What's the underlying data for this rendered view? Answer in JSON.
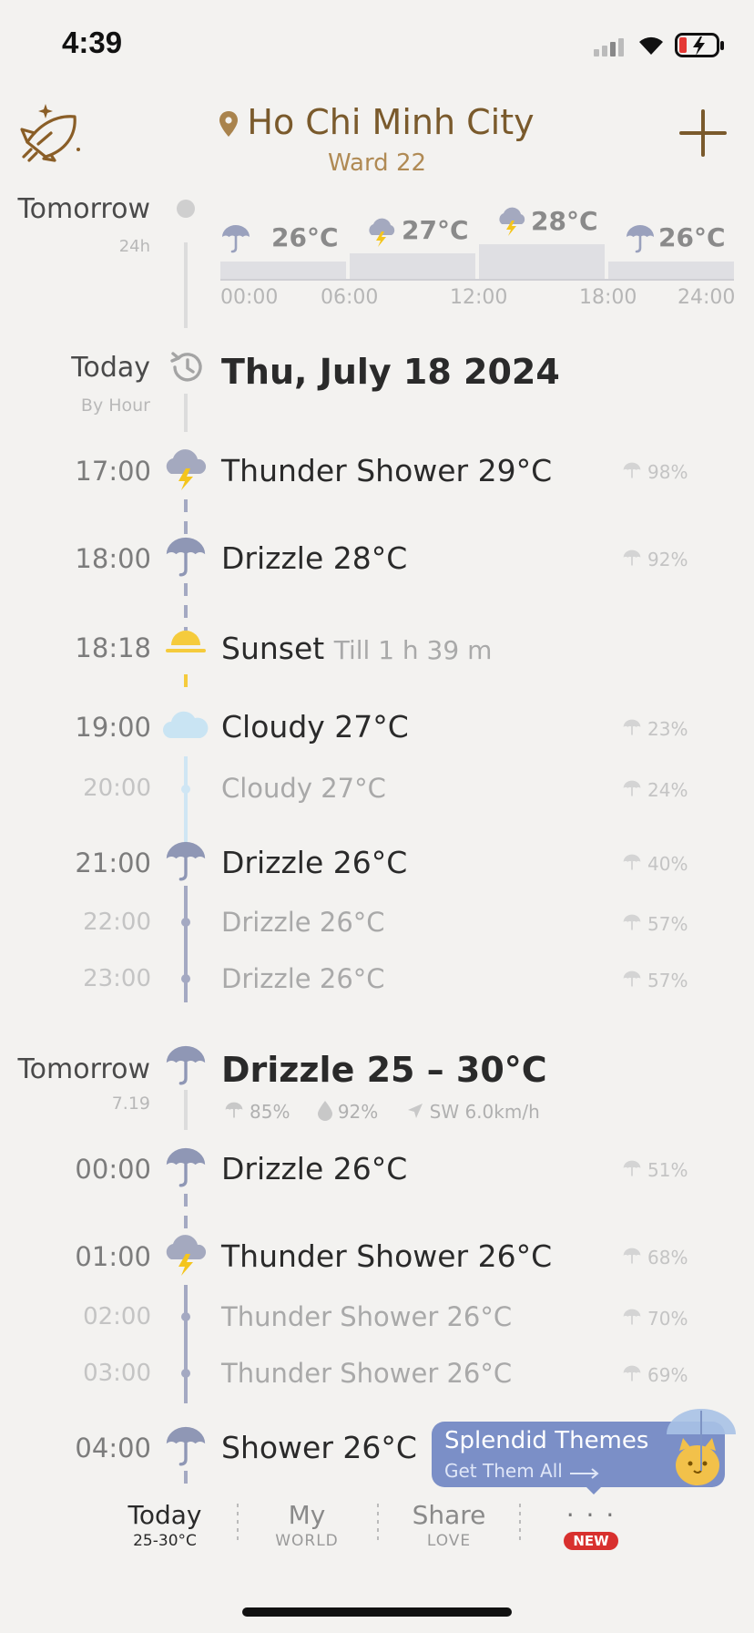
{
  "status": {
    "time": "4:39"
  },
  "header": {
    "city": "Ho Chi Minh City",
    "ward": "Ward 22"
  },
  "tomorrow_overview": {
    "label": "Tomorrow",
    "sub": "24h",
    "temps": [
      "26°C",
      "27°C",
      "28°C",
      "26°C"
    ],
    "axis": [
      "00:00",
      "06:00",
      "12:00",
      "18:00",
      "24:00"
    ]
  },
  "today": {
    "label": "Today",
    "sub": "By Hour",
    "date": "Thu, July 18 2024"
  },
  "hours": [
    {
      "time": "17:00",
      "desc": "Thunder Shower 29°C",
      "pct": "98%"
    },
    {
      "time": "18:00",
      "desc": "Drizzle 28°C",
      "pct": "92%"
    },
    {
      "time": "18:18",
      "desc": "Sunset",
      "extra": "Till 1 h 39 m"
    },
    {
      "time": "19:00",
      "desc": "Cloudy 27°C",
      "pct": "23%"
    },
    {
      "time": "20:00",
      "desc": "Cloudy 27°C",
      "pct": "24%"
    },
    {
      "time": "21:00",
      "desc": "Drizzle 26°C",
      "pct": "40%"
    },
    {
      "time": "22:00",
      "desc": "Drizzle 26°C",
      "pct": "57%"
    },
    {
      "time": "23:00",
      "desc": "Drizzle 26°C",
      "pct": "57%"
    }
  ],
  "tomorrow": {
    "label": "Tomorrow",
    "sub": "7.19",
    "summary": "Drizzle 25 – 30°C",
    "rain": "85%",
    "humidity": "92%",
    "wind": "SW 6.0km/h"
  },
  "hours2": [
    {
      "time": "00:00",
      "desc": "Drizzle 26°C",
      "pct": "51%"
    },
    {
      "time": "01:00",
      "desc": "Thunder Shower 26°C",
      "pct": "68%"
    },
    {
      "time": "02:00",
      "desc": "Thunder Shower 26°C",
      "pct": "70%"
    },
    {
      "time": "03:00",
      "desc": "Thunder Shower 26°C",
      "pct": "69%"
    },
    {
      "time": "04:00",
      "desc": "Shower 26°C"
    }
  ],
  "promo": {
    "title": "Splendid Themes",
    "cta": "Get Them All"
  },
  "nav": {
    "today": {
      "label": "Today",
      "sub": "25-30°C"
    },
    "world": {
      "label": "My",
      "sub": "WORLD"
    },
    "share": {
      "label": "Share",
      "sub": "LOVE"
    },
    "more": {
      "label": "· · ·",
      "badge": "NEW"
    }
  },
  "colors": {
    "accent": "#7a5a2c",
    "umbrella": "#8f97b5",
    "badge": "#d8302e",
    "promo": "#7b8fc7"
  }
}
